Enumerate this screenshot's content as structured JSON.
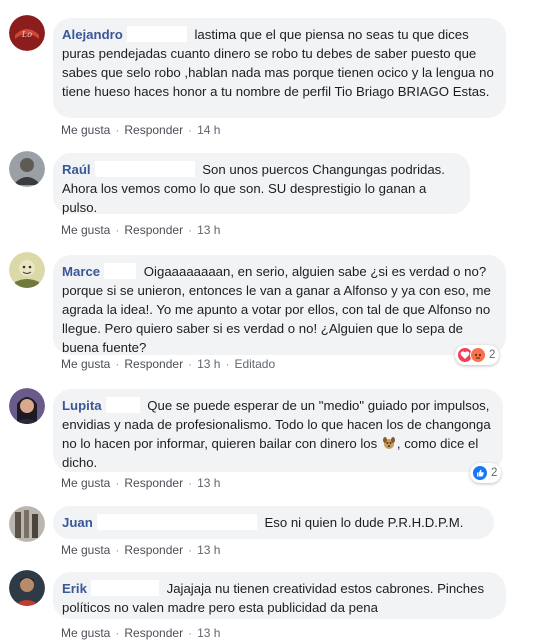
{
  "actions": {
    "like": "Me gusta",
    "reply": "Responder",
    "separator": "·"
  },
  "comments": [
    {
      "author": "Alejandro",
      "text": "lastima que el que piensa no seas tu que dices puras pendejadas cuanto dinero se robo tu debes de saber puesto que sabes que selo robo ,hablan nada mas porque tienen ocico y la lengua no tiene hueso haces honor a tu nombre de perfil Tio Briago BRIAGO Estas.",
      "time": "14 h"
    },
    {
      "author": "Raúl",
      "text": "Son unos puercos Changungas podridas. Ahora los vemos como lo que son. SU desprestigio lo ganan a pulso.",
      "time": "13 h"
    },
    {
      "author": "Marce",
      "text": "Oigaaaaaaaan, en serio, alguien sabe ¿si es verdad o no? porque si se unieron, entonces le van a ganar a Alfonso y ya con eso, me agrada la idea!. Yo me apunto a votar por ellos, con tal de que Alfonso no llegue. Pero quiero saber si es verdad o no! ¿Alguien que lo sepa de buena fuente?",
      "time": "13 h",
      "edited": "Editado",
      "reaction_count": "2"
    },
    {
      "author": "Lupita",
      "text_before": "Que se puede esperar de un \"medio\" guiado por impulsos, envidias y nada de profesionalismo. Todo lo que hacen los de changonga no lo hacen por informar, quieren bailar con dinero los ",
      "text_after": ", como dice el dicho.",
      "time": "13 h",
      "reaction_count": "2"
    },
    {
      "author": "Juan",
      "text": "Eso ni quien lo dude P.R.H.D.P.M.",
      "time": "13 h"
    },
    {
      "author": "Erik",
      "text": "Jajajaja nu tienen creatividad estos cabrones. Pinches políticos no valen madre pero esta publicidad da pena",
      "time": "13 h"
    }
  ]
}
